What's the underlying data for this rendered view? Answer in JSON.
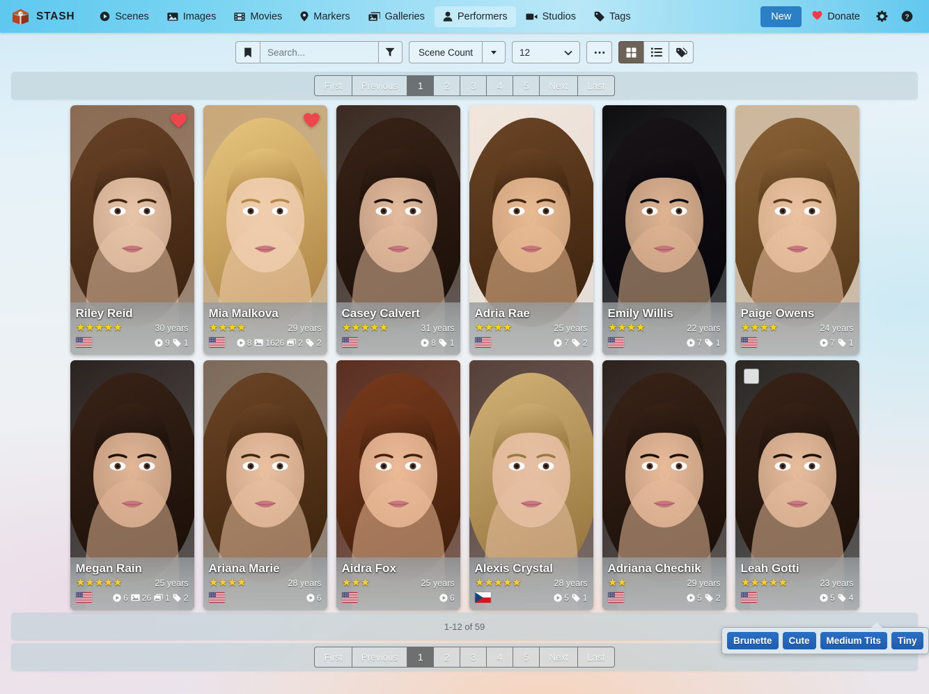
{
  "navbar": {
    "brand": "STASH",
    "brand_icon": "stash-box-logo",
    "links": [
      {
        "label": "Scenes",
        "icon": "play-circle-icon",
        "active": false
      },
      {
        "label": "Images",
        "icon": "image-icon",
        "active": false
      },
      {
        "label": "Movies",
        "icon": "film-icon",
        "active": false
      },
      {
        "label": "Markers",
        "icon": "map-pin-icon",
        "active": false
      },
      {
        "label": "Galleries",
        "icon": "images-icon",
        "active": false
      },
      {
        "label": "Performers",
        "icon": "user-icon",
        "active": true
      },
      {
        "label": "Studios",
        "icon": "video-icon",
        "active": false
      },
      {
        "label": "Tags",
        "icon": "tag-icon",
        "active": false
      }
    ],
    "new_label": "New",
    "donate_label": "Donate",
    "donate_icon": "heart-icon",
    "settings_icon": "gear-icon",
    "help_icon": "question-circle-icon",
    "accent_color": "#2b7fc4",
    "navbar_color": "#8fd9f2"
  },
  "toolbar": {
    "bookmark_icon": "bookmark-icon",
    "search_value": "",
    "search_placeholder": "Search...",
    "filter_icon": "funnel-icon",
    "sort_by": "Scene Count",
    "sort_direction_icon": "caret-down-icon",
    "per_page": "12",
    "more_icon": "ellipsis-icon",
    "view_modes": [
      {
        "name": "grid",
        "icon": "grid-view-icon",
        "active": true
      },
      {
        "name": "list",
        "icon": "list-view-icon",
        "active": false
      },
      {
        "name": "tagger",
        "icon": "tag-view-icon",
        "active": false
      }
    ]
  },
  "pagination": {
    "first": "First",
    "previous": "Previous",
    "pages": [
      "1",
      "2",
      "3",
      "4",
      "5"
    ],
    "active_page": "1",
    "next": "Next",
    "last": "Last"
  },
  "result_count": "1-12 of 59",
  "performers": [
    {
      "name": "Riley Reid",
      "rating": 5,
      "age": "30 years",
      "country": "us",
      "scenes": "9",
      "images": null,
      "galleries": null,
      "tags": "1",
      "favorite": true,
      "selected": false,
      "hair": "brown-long",
      "skin": "#e8c4a8",
      "bg": "#8a6a52"
    },
    {
      "name": "Mia Malkova",
      "rating": 4,
      "age": "29 years",
      "country": "us",
      "scenes": "8",
      "images": "1626",
      "galleries": "2",
      "tags": "2",
      "favorite": true,
      "selected": false,
      "hair": "blonde-long",
      "skin": "#f0cdae",
      "bg": "#c9a878"
    },
    {
      "name": "Casey Calvert",
      "rating": 5,
      "age": "31 years",
      "country": "us",
      "scenes": "8",
      "images": null,
      "galleries": null,
      "tags": "1",
      "favorite": false,
      "selected": false,
      "hair": "brown-dark",
      "skin": "#e4bb9d",
      "bg": "#3a2a22"
    },
    {
      "name": "Adria Rae",
      "rating": 4,
      "age": "25 years",
      "country": "us",
      "scenes": "7",
      "images": null,
      "galleries": null,
      "tags": "2",
      "favorite": false,
      "selected": false,
      "hair": "brown-mid",
      "skin": "#e9bb93",
      "bg": "#f2e6dc"
    },
    {
      "name": "Emily Willis",
      "rating": 4,
      "age": "22 years",
      "country": "us",
      "scenes": "7",
      "images": null,
      "galleries": null,
      "tags": "1",
      "favorite": false,
      "selected": false,
      "hair": "black-long",
      "skin": "#dfb492",
      "bg": "#0d0d10"
    },
    {
      "name": "Paige Owens",
      "rating": 4,
      "age": "24 years",
      "country": "us",
      "scenes": "7",
      "images": null,
      "galleries": null,
      "tags": "1",
      "favorite": false,
      "selected": false,
      "hair": "brown-light",
      "skin": "#ecc3a2",
      "bg": "#cdb79c"
    },
    {
      "name": "Megan Rain",
      "rating": 5,
      "age": "25 years",
      "country": "us",
      "scenes": "6",
      "images": "26",
      "galleries": "1",
      "tags": "2",
      "favorite": false,
      "selected": false,
      "hair": "brown-dark",
      "skin": "#e2b696",
      "bg": "#2b2320"
    },
    {
      "name": "Ariana Marie",
      "rating": 4,
      "age": "28 years",
      "country": "us",
      "scenes": "6",
      "images": null,
      "galleries": null,
      "tags": null,
      "favorite": false,
      "selected": false,
      "hair": "brown-mid",
      "skin": "#e9c0a0",
      "bg": "#7d6a5a"
    },
    {
      "name": "Aidra Fox",
      "rating": 3,
      "age": "25 years",
      "country": "us",
      "scenes": "6",
      "images": null,
      "galleries": null,
      "tags": null,
      "favorite": false,
      "selected": false,
      "hair": "auburn",
      "skin": "#ecbb98",
      "bg": "#5a2f20"
    },
    {
      "name": "Alexis Crystal",
      "rating": 5,
      "age": "28 years",
      "country": "cz",
      "scenes": "5",
      "images": null,
      "galleries": null,
      "tags": "1",
      "favorite": false,
      "selected": false,
      "hair": "blonde-dirty",
      "skin": "#e7c0a4",
      "bg": "#57413a"
    },
    {
      "name": "Adriana Chechik",
      "rating": 2,
      "age": "29 years",
      "country": "us",
      "scenes": "5",
      "images": null,
      "galleries": null,
      "tags": "2",
      "favorite": false,
      "selected": false,
      "hair": "brown-dark",
      "skin": "#e8bb9a",
      "bg": "#2d221d"
    },
    {
      "name": "Leah Gotti",
      "rating": 5,
      "age": "23 years",
      "country": "us",
      "scenes": "5",
      "images": null,
      "galleries": null,
      "tags": "4",
      "favorite": false,
      "selected": true,
      "hair": "brown-dark",
      "skin": "#e7bd9c",
      "bg": "#2a2724"
    }
  ],
  "tag_popover": {
    "tags": [
      "Brunette",
      "Cute",
      "Medium Tits",
      "Tiny"
    ],
    "badge_color": "#2363b8"
  }
}
